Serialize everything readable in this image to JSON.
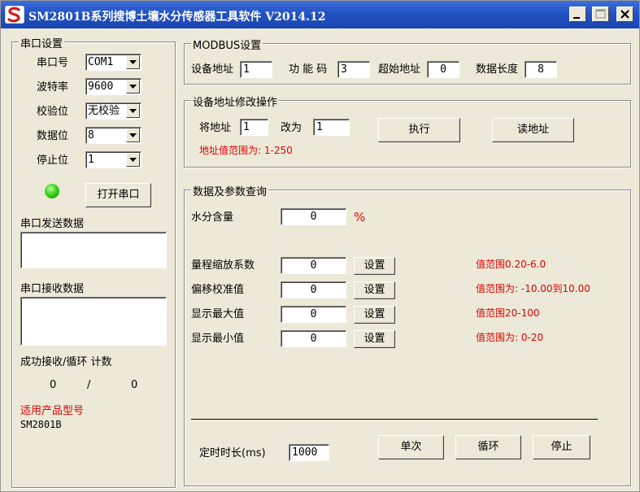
{
  "window": {
    "title": "SM2801B系列搜博土壤水分传感器工具软件 V2014.12",
    "minimize": "minimize",
    "maximize": "maximize",
    "close": "close"
  },
  "serial": {
    "legend": "串口设置",
    "port_label": "串口号",
    "port_value": "COM1",
    "baud_label": "波特率",
    "baud_value": "9600",
    "parity_label": "校验位",
    "parity_value": "无校验",
    "databits_label": "数据位",
    "databits_value": "8",
    "stopbits_label": "停止位",
    "stopbits_value": "1",
    "open_button": "打开串口",
    "send_label": "串口发送数据",
    "recv_label": "串口接收数据",
    "counter_label": "成功接收/循环 计数",
    "success_count": "0",
    "separator": "/",
    "loop_count": "0",
    "product_label": "适用产品型号",
    "product_model": "SM2801B"
  },
  "modbus": {
    "legend": "MODBUS设置",
    "device_addr_label": "设备地址",
    "device_addr_value": "1",
    "function_code_label": "功 能 码",
    "function_code_value": "3",
    "start_addr_label": "超始地址",
    "start_addr_value": "0",
    "data_len_label": "数据长度",
    "data_len_value": "8"
  },
  "addr_change": {
    "legend": "设备地址修改操作",
    "from_label": "将地址",
    "from_value": "1",
    "to_label": "改为",
    "to_value": "1",
    "execute_button": "执行",
    "read_button": "读地址",
    "range_hint": "地址值范围为: 1-250"
  },
  "query": {
    "legend": "数据及参数查询",
    "moisture_label": "水分含量",
    "moisture_value": "0",
    "moisture_unit": "%",
    "set_label": "设置",
    "params": [
      {
        "label": "量程缩放系数",
        "value": "0",
        "range": "值范围0.20-6.0"
      },
      {
        "label": "偏移校准值",
        "value": "0",
        "range": "值范围为: -10.00到10.00"
      },
      {
        "label": "显示最大值",
        "value": "0",
        "range": "值范围20-100"
      },
      {
        "label": "显示最小值",
        "value": "0",
        "range": "值范围为: 0-20"
      }
    ],
    "timer_label": "定时时长(ms)",
    "timer_value": "1000",
    "single_button": "单次",
    "loop_button": "循环",
    "stop_button": "停止"
  }
}
